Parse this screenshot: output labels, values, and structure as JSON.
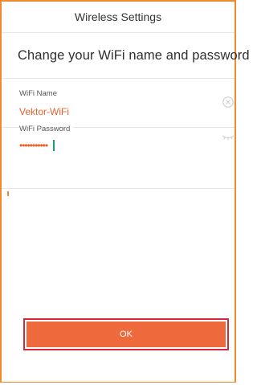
{
  "header": {
    "title": "Wireless Settings"
  },
  "main": {
    "heading": "Change your WiFi name and password",
    "wifi_name": {
      "label": "WiFi Name",
      "value": "Vektor-WiFi",
      "clear_icon": "clear-circle-x-icon"
    },
    "wifi_password": {
      "label": "WiFi Password",
      "masked_value": "•••••••••••",
      "visibility_icon": "eye-closed-icon"
    }
  },
  "footer": {
    "ok_label": "OK"
  },
  "colors": {
    "accent": "#ee6a3d",
    "frame_border": "#f08a2c",
    "value_text": "#e8612c",
    "highlight_border": "#d3283d",
    "cursor": "#1a9e7a"
  }
}
